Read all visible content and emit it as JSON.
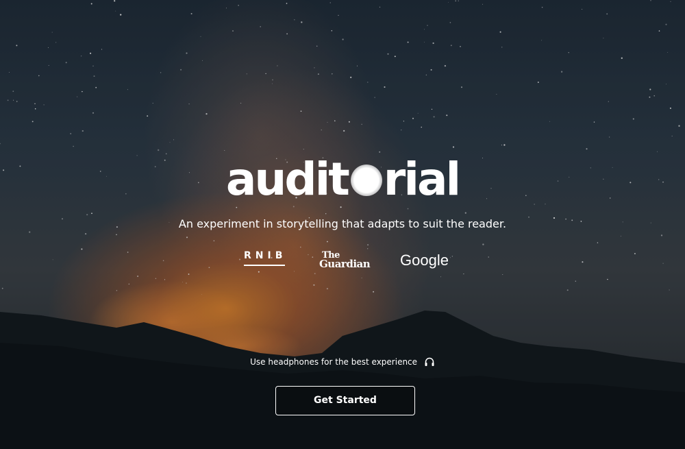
{
  "brand": {
    "name_before_dot": "audit",
    "name_after_dot": "rial"
  },
  "tagline": "An experiment in storytelling that adapts to suit the reader.",
  "partners": {
    "rnib": "RNIB",
    "guardian_the": "The",
    "guardian_name": "Guardian",
    "google": "Google"
  },
  "hint": {
    "text": "Use headphones for the best experience",
    "icon": "headphones-icon"
  },
  "cta": {
    "label": "Get Started"
  },
  "background": {
    "icon": "forest-fire-night-sky-photo"
  }
}
